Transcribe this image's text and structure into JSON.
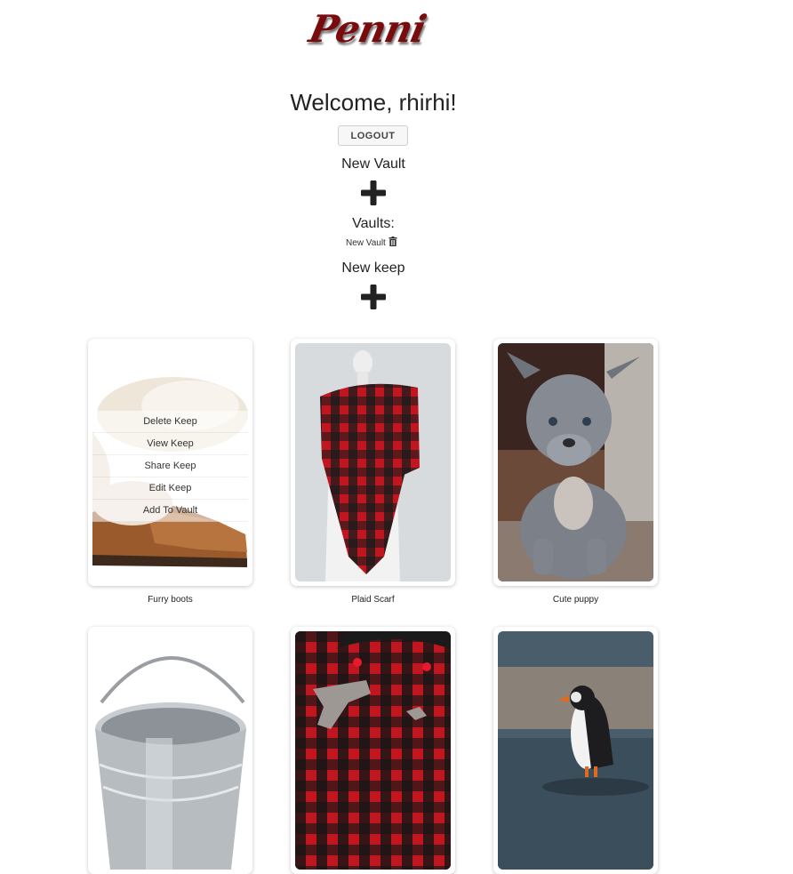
{
  "brand": {
    "logo_text": "Penni"
  },
  "header": {
    "welcome": "Welcome, rhirhi!",
    "logout_label": "LOGOUT"
  },
  "vault_section": {
    "new_vault_label": "New Vault",
    "vaults_heading": "Vaults:",
    "vaults": [
      "New Vault"
    ]
  },
  "keep_section": {
    "new_keep_label": "New keep"
  },
  "keep_menu": [
    "Delete Keep",
    "View Keep",
    "Share Keep",
    "Edit Keep",
    "Add To Vault"
  ],
  "keeps": [
    {
      "caption": "Furry boots"
    },
    {
      "caption": "Plaid Scarf"
    },
    {
      "caption": "Cute puppy"
    },
    {
      "caption": ""
    },
    {
      "caption": ""
    },
    {
      "caption": ""
    }
  ]
}
